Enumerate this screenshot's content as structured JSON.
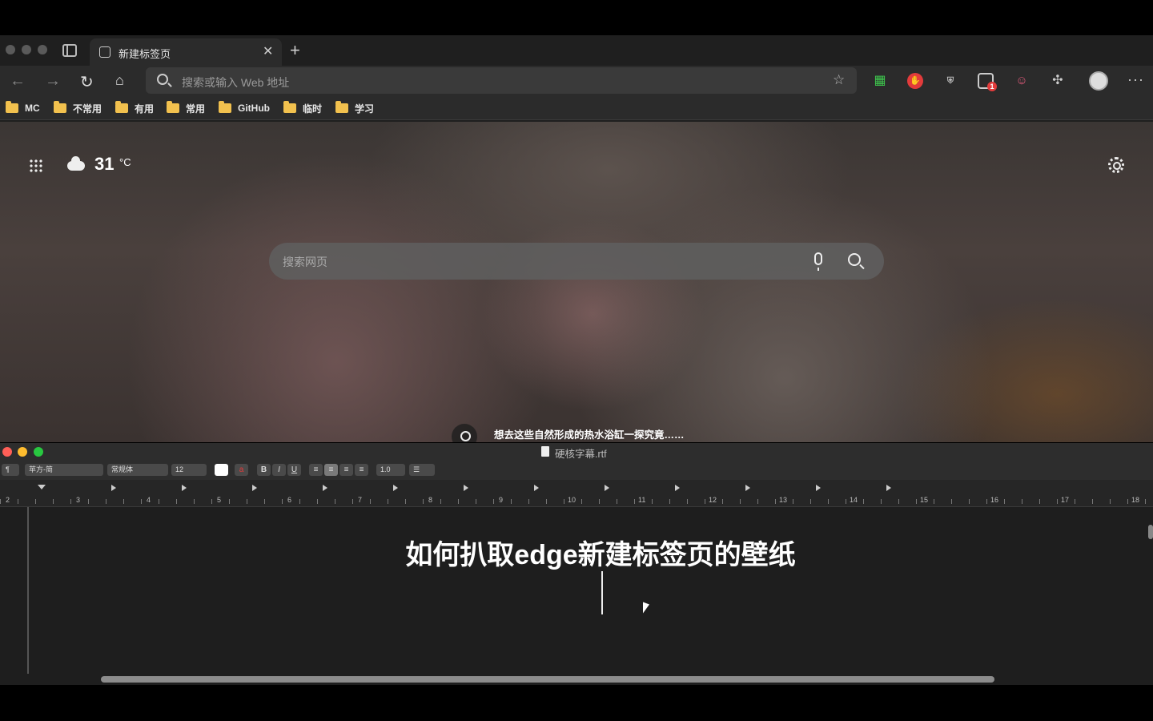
{
  "browser": {
    "tab_title": "新建标签页",
    "address_placeholder": "搜索或输入 Web 地址",
    "extension_badge": "1",
    "bookmarks": [
      "MC",
      "不常用",
      "有用",
      "常用",
      "GitHub",
      "临时",
      "学习"
    ]
  },
  "new_tab_page": {
    "temperature": "31",
    "temperature_unit": "°C",
    "search_placeholder": "搜索网页",
    "image_caption": "想去这些自然形成的热水浴缸一探究竟……"
  },
  "editor": {
    "filename": "硬核字幕.rtf",
    "paragraph_style": "¶",
    "font_family": "苹方-简",
    "font_style": "常规体",
    "font_size": "12",
    "bold": "B",
    "italic": "I",
    "underline": "U",
    "line_spacing": "1.0",
    "ruler_numbers": [
      "2",
      "3",
      "4",
      "5",
      "6",
      "7",
      "8",
      "9",
      "10",
      "11",
      "12",
      "13",
      "14",
      "15",
      "16",
      "17",
      "18"
    ],
    "document_text": "如何扒取edge新建标签页的壁纸"
  },
  "colors": {
    "accent_close": "#ff5f57",
    "accent_minimize": "#febc2e",
    "accent_zoom": "#28c840",
    "folder": "#f2c14e"
  }
}
